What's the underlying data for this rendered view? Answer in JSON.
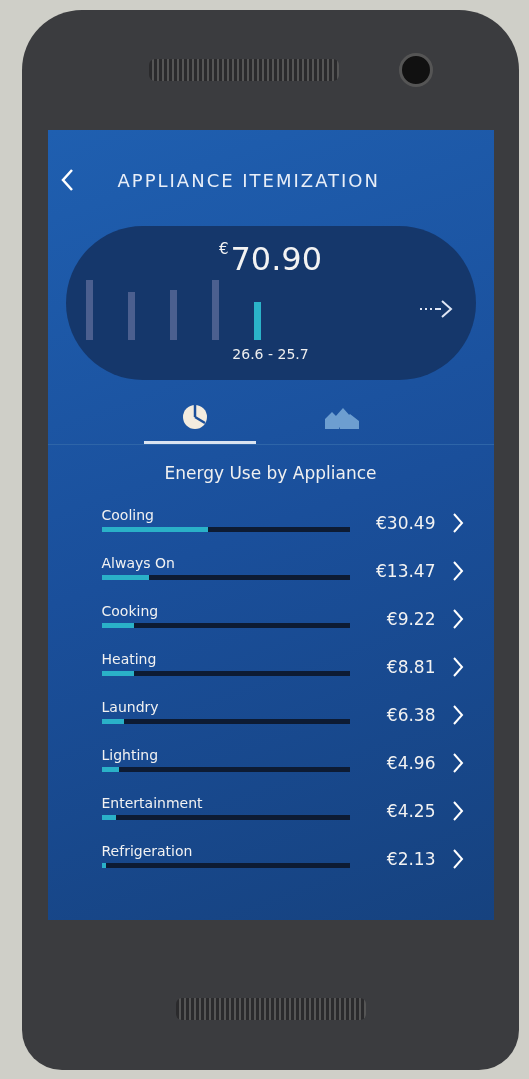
{
  "header": {
    "title": "APPLIANCE ITEMIZATION"
  },
  "summary": {
    "currency": "€",
    "amount": "70.90",
    "period": "26.6 - 25.7"
  },
  "tabs": [
    {
      "kind": "pie",
      "selected": true
    },
    {
      "kind": "homes",
      "selected": false
    }
  ],
  "section_title": "Energy Use by Appliance",
  "appliances": [
    {
      "name": "Cooling",
      "amount": "€30.49",
      "level": 0.43
    },
    {
      "name": "Always On",
      "amount": "€13.47",
      "level": 0.19
    },
    {
      "name": "Cooking",
      "amount": "€9.22",
      "level": 0.13
    },
    {
      "name": "Heating",
      "amount": "€8.81",
      "level": 0.13
    },
    {
      "name": "Laundry",
      "amount": "€6.38",
      "level": 0.09
    },
    {
      "name": "Lighting",
      "amount": "€4.96",
      "level": 0.07
    },
    {
      "name": "Entertainment",
      "amount": "€4.25",
      "level": 0.06
    },
    {
      "name": "Refrigeration",
      "amount": "€2.13",
      "level": 0.02
    }
  ]
}
